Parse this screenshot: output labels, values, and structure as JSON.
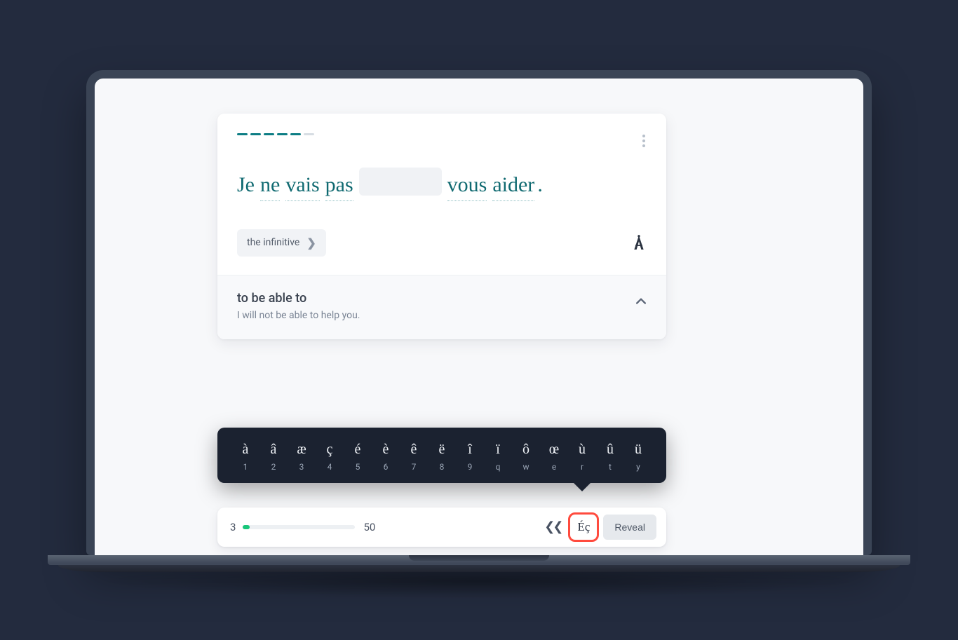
{
  "progress_dashes": {
    "filled": 5,
    "total": 6
  },
  "sentence": {
    "words": [
      "Je",
      "ne",
      "vais",
      "pas",
      null,
      "vous",
      "aider"
    ],
    "noline_indices": [
      0
    ],
    "blank_index": 4
  },
  "hint": {
    "label": "the infinitive"
  },
  "translation": {
    "title": "to be able to",
    "subtitle": "I will not be able to help you."
  },
  "accents": {
    "chars": [
      "à",
      "â",
      "æ",
      "ç",
      "é",
      "è",
      "ê",
      "ë",
      "î",
      "ï",
      "ô",
      "œ",
      "ù",
      "û",
      "ü"
    ],
    "keys": [
      "1",
      "2",
      "3",
      "4",
      "5",
      "6",
      "7",
      "8",
      "9",
      "q",
      "w",
      "e",
      "r",
      "t",
      "y"
    ]
  },
  "bottom": {
    "current": "3",
    "total": "50",
    "percent": 6,
    "accent_toggle": "Éç",
    "reveal": "Reveal"
  }
}
